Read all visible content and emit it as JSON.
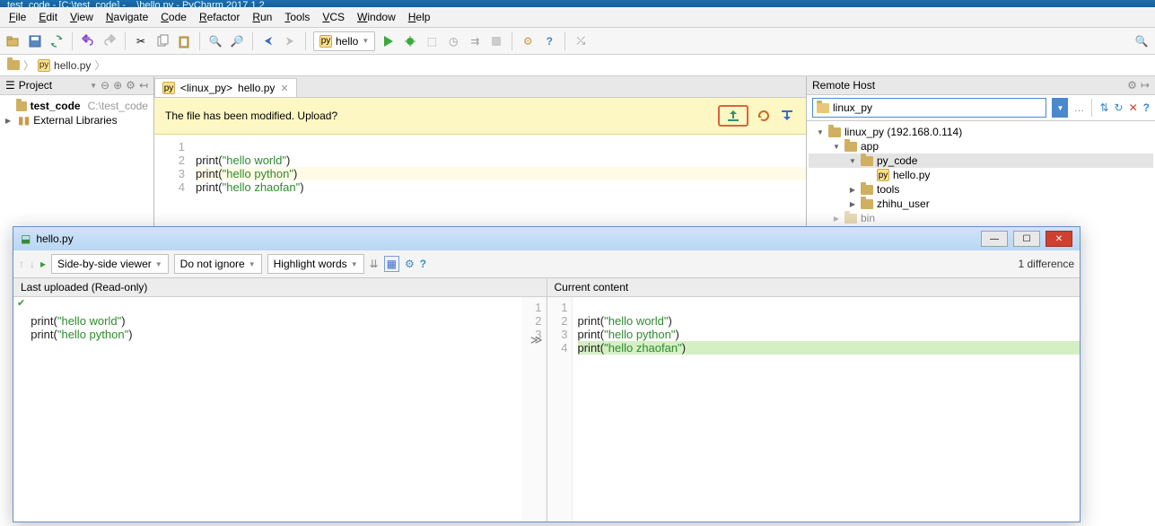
{
  "title_bar": "test_code - [C:\\test_code] - ...\\hello.py - PyCharm 2017.1.2",
  "menu": [
    "File",
    "Edit",
    "View",
    "Navigate",
    "Code",
    "Refactor",
    "Run",
    "Tools",
    "VCS",
    "Window",
    "Help"
  ],
  "run_config": "hello",
  "breadcrumbs": {
    "folder": "",
    "file": "hello.py"
  },
  "project": {
    "title": "Project",
    "root": {
      "name": "test_code",
      "path": "C:\\test_code"
    },
    "external": "External Libraries"
  },
  "editor": {
    "tab_prefix": "<linux_py>",
    "tab_label": "hello.py",
    "notice": "The file has been modified. Upload?",
    "lines": [
      {
        "n": "1",
        "text": ""
      },
      {
        "n": "2",
        "call": "print",
        "arg": "\"hello world\"",
        "hl": false
      },
      {
        "n": "3",
        "call": "print",
        "arg": "\"hello python\"",
        "hl": true
      },
      {
        "n": "4",
        "call": "print",
        "arg": "\"hello zhaofan\"",
        "hl": false
      }
    ]
  },
  "remote": {
    "title": "Remote Host",
    "selected": "linux_py",
    "tree": [
      {
        "indent": 0,
        "name": "linux_py (192.168.0.114)",
        "open": true,
        "type": "root"
      },
      {
        "indent": 1,
        "name": "app",
        "open": true,
        "type": "folder"
      },
      {
        "indent": 2,
        "name": "py_code",
        "open": true,
        "type": "folder",
        "sel": true
      },
      {
        "indent": 3,
        "name": "hello.py",
        "type": "py"
      },
      {
        "indent": 2,
        "name": "tools",
        "type": "folder",
        "closed": true
      },
      {
        "indent": 2,
        "name": "zhihu_user",
        "type": "folder",
        "closed": true
      },
      {
        "indent": 1,
        "name": "bin",
        "type": "folder",
        "closed": true,
        "dim": true
      }
    ]
  },
  "diff": {
    "title": "hello.py",
    "viewer_mode": "Side-by-side viewer",
    "ignore_mode": "Do not ignore",
    "highlight_mode": "Highlight words",
    "summary": "1 difference",
    "left_title": "Last uploaded (Read-only)",
    "right_title": "Current content",
    "left": [
      {
        "n": "1",
        "text": ""
      },
      {
        "n": "2",
        "call": "print",
        "arg": "\"hello world\""
      },
      {
        "n": "3",
        "call": "print",
        "arg": "\"hello python\""
      }
    ],
    "right": [
      {
        "n": "1",
        "text": ""
      },
      {
        "n": "2",
        "call": "print",
        "arg": "\"hello world\""
      },
      {
        "n": "3",
        "call": "print",
        "arg": "\"hello python\""
      },
      {
        "n": "4",
        "call": "print",
        "arg": "\"hello zhaofan\"",
        "added": true
      }
    ]
  }
}
